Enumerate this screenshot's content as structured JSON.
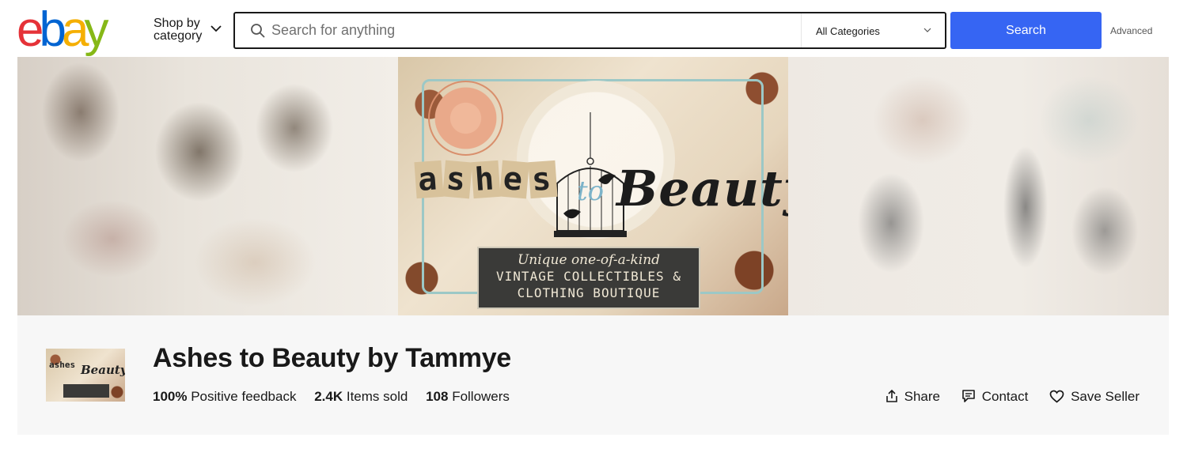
{
  "header": {
    "logo_letters": [
      "e",
      "b",
      "a",
      "y"
    ],
    "shop_by_category_label": "Shop by category",
    "search": {
      "placeholder": "Search for anything",
      "value": "",
      "icon": "magnifier-icon"
    },
    "category_select": {
      "selected": "All Categories",
      "icon": "chevron-down-icon"
    },
    "search_button_label": "Search",
    "advanced_label": "Advanced"
  },
  "banner": {
    "tagline": "Unique one-of-a-kind",
    "line1": "VINTAGE COLLECTIBLES &",
    "line2": "CLOTHING BOUTIQUE",
    "art_words": {
      "ashes_letters": [
        "a",
        "s",
        "h",
        "e",
        "s"
      ],
      "to": "to",
      "beauty": "Beauty"
    }
  },
  "seller": {
    "name": "Ashes to Beauty by Tammye",
    "stats": [
      {
        "value": "100%",
        "label": "Positive feedback"
      },
      {
        "value": "2.4K",
        "label": "Items sold"
      },
      {
        "value": "108",
        "label": "Followers"
      }
    ],
    "actions": [
      {
        "label": "Share",
        "icon": "share-icon"
      },
      {
        "label": "Contact",
        "icon": "chat-icon"
      },
      {
        "label": "Save Seller",
        "icon": "heart-icon"
      }
    ]
  },
  "colors": {
    "ebay_red": "#e53238",
    "ebay_blue": "#0064d2",
    "ebay_yellow": "#f5af02",
    "ebay_green": "#86b817",
    "search_button": "#3665f3",
    "seller_bar_bg": "#f7f7f7"
  }
}
